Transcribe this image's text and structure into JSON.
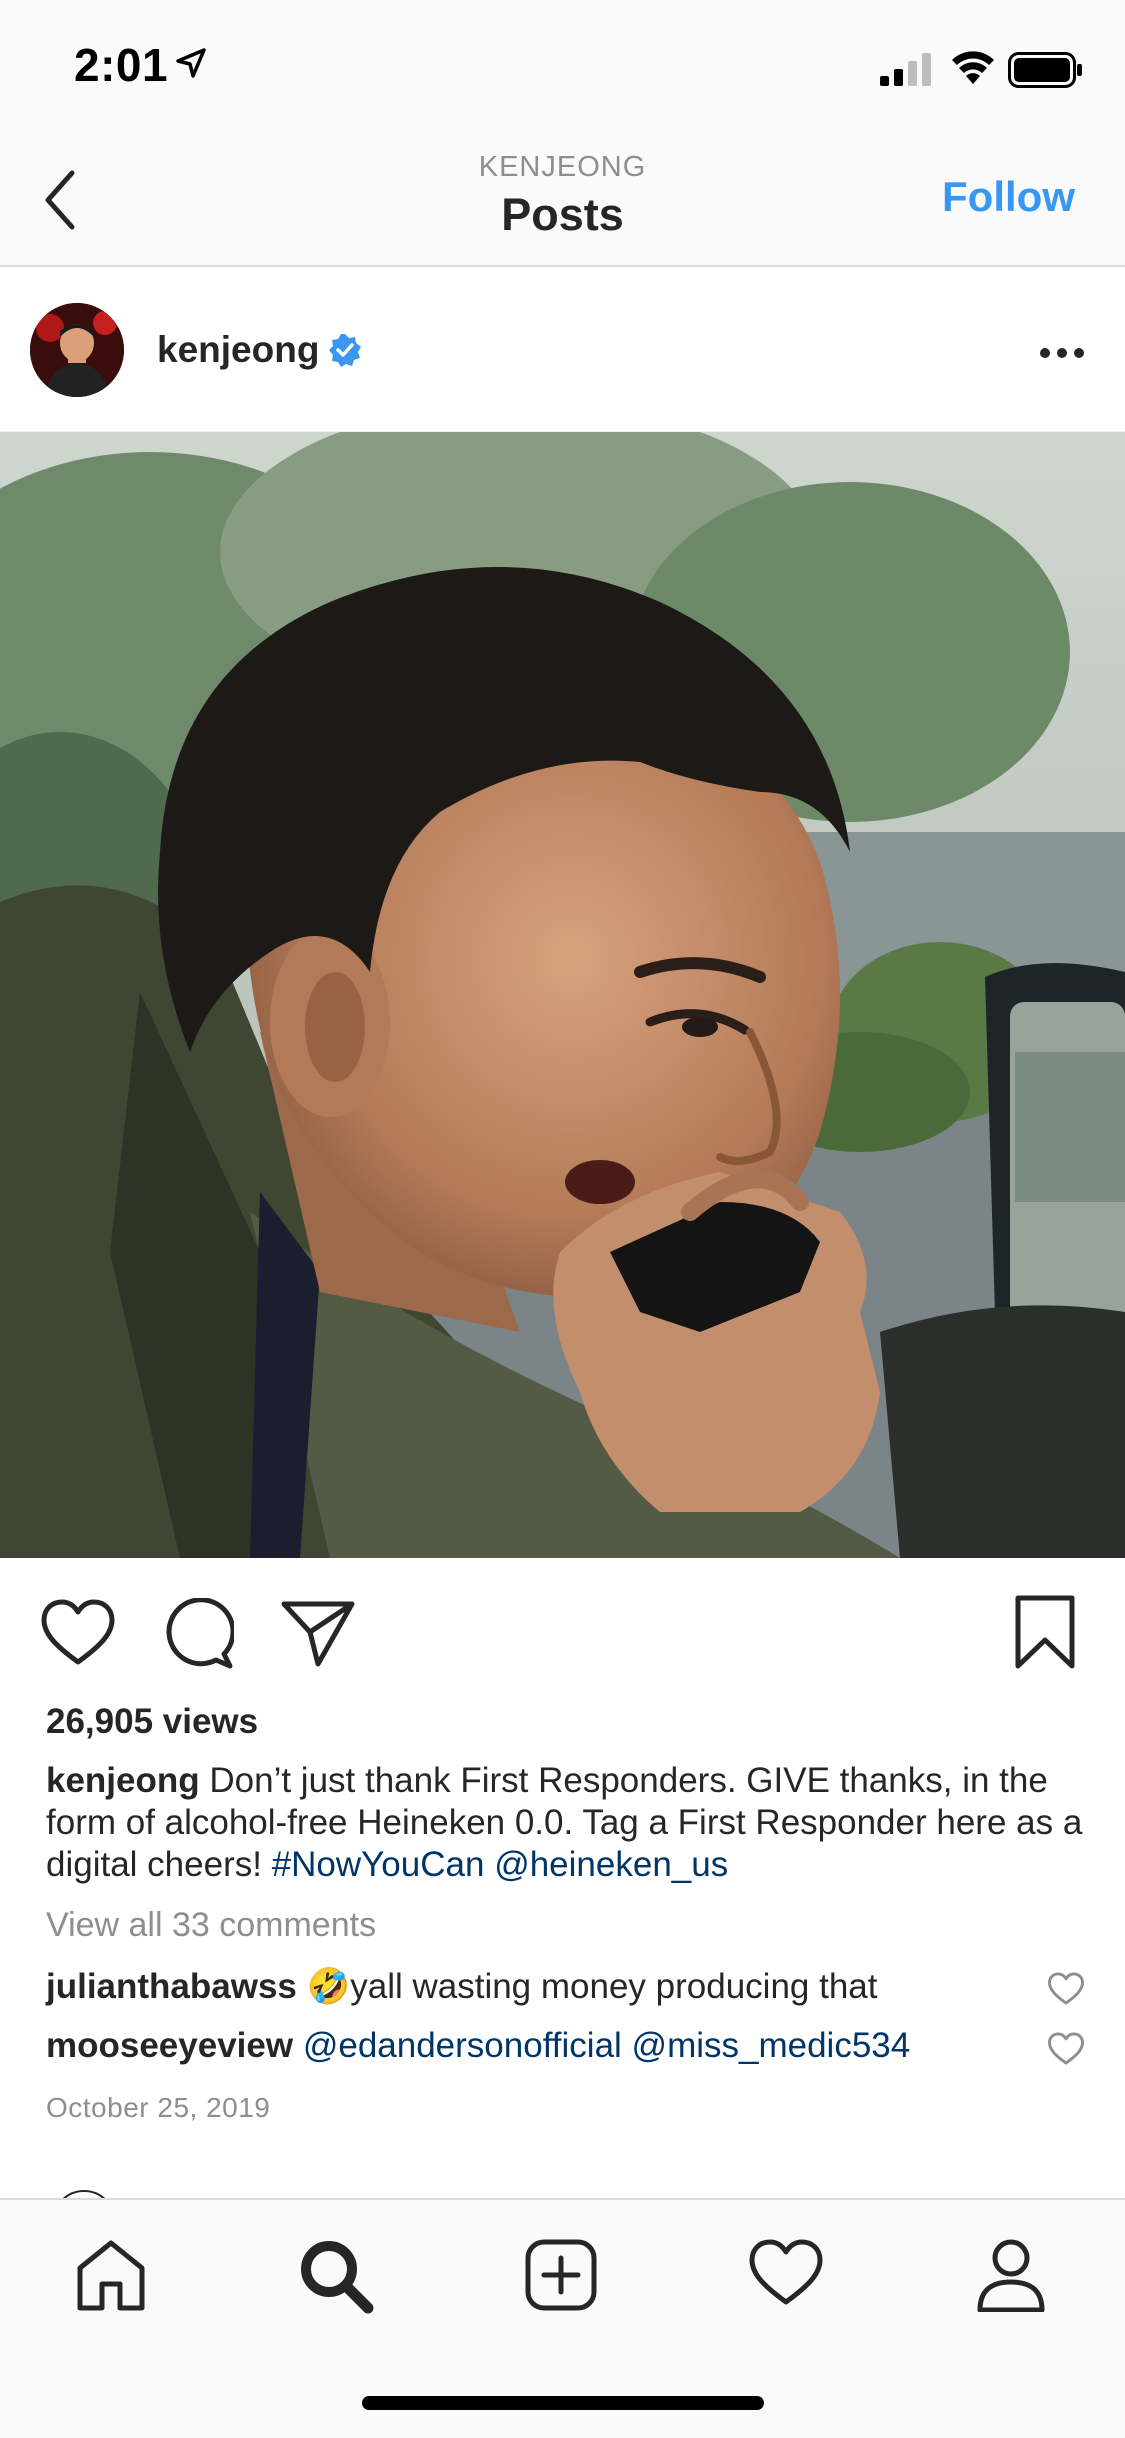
{
  "status_bar": {
    "time": "2:01"
  },
  "nav": {
    "subtitle": "KENJEONG",
    "title": "Posts",
    "follow_label": "Follow"
  },
  "post": {
    "username": "kenjeong",
    "views": "26,905 views",
    "caption": {
      "username": "kenjeong",
      "text": "Don’t just thank First Responders. GIVE thanks, in the form of alcohol-free Heineken 0.0. Tag a First Responder here as a digital cheers!",
      "hashtag": "#NowYouCan",
      "mention": "@heineken_us"
    },
    "view_all_comments": "View all 33 comments",
    "comments": [
      {
        "user": "julianthabawss",
        "emoji": "🤣",
        "text": "yall wasting money producing that"
      },
      {
        "user": "mooseeyeview",
        "mention1": "@edandersonofficial",
        "mention2": "@miss_medic534"
      }
    ],
    "date": "October 25, 2019"
  },
  "icons": {
    "back": "chevron-left-icon",
    "verified": "verified-badge-icon",
    "more": "more-options-icon",
    "like": "heart-icon",
    "comment": "comment-icon",
    "share": "send-icon",
    "save": "bookmark-icon",
    "tabs": [
      "home-icon",
      "search-icon",
      "new-post-icon",
      "activity-icon",
      "profile-icon"
    ]
  },
  "colors": {
    "accent": "#3897f0",
    "link": "#003569",
    "muted": "#8e8e8e",
    "text": "#262626"
  }
}
